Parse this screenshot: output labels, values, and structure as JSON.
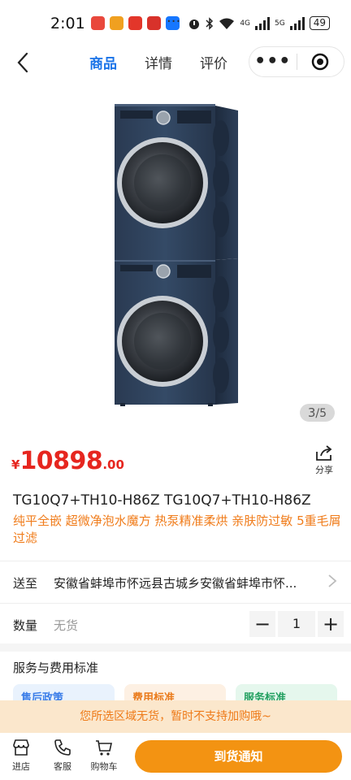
{
  "status_bar": {
    "time": "2:01",
    "more": "···",
    "network": "4G",
    "network2": "5G",
    "battery": "49"
  },
  "nav": {
    "tabs": [
      {
        "label": "商品",
        "active": true
      },
      {
        "label": "详情",
        "active": false
      },
      {
        "label": "评价",
        "active": false
      }
    ],
    "menu_icon": "more-dots-icon",
    "close_icon": "target-icon"
  },
  "gallery": {
    "current": "3",
    "separator": "/",
    "total": "5"
  },
  "price": {
    "currency": "¥",
    "integer": "10898",
    "decimal": ".00",
    "color": "#e6261f"
  },
  "share": {
    "label": "分享"
  },
  "product": {
    "title": "TG10Q7+TH10-H86Z TG10Q7+TH10-H86Z",
    "subtitle": "纯平全嵌 超微净泡水魔方 热泵精准柔烘 亲肤防过敏 5重毛屑过滤"
  },
  "delivery": {
    "label": "送至",
    "address": "安徽省蚌埠市怀远县古城乡安徽省蚌埠市怀..."
  },
  "quantity": {
    "label": "数量",
    "stock_status": "无货",
    "value": "1",
    "minus": "−",
    "plus": "+"
  },
  "services": {
    "title": "服务与费用标准",
    "cards": [
      {
        "label": "售后政策"
      },
      {
        "label": "费用标准"
      },
      {
        "label": "服务标准"
      }
    ]
  },
  "notice": {
    "text": "您所选区域无货，暂时不支持加购哦~"
  },
  "bottom_bar": {
    "store": "进店",
    "service": "客服",
    "cart": "购物车",
    "cta": "到货通知",
    "cta_color": "#f39312"
  }
}
